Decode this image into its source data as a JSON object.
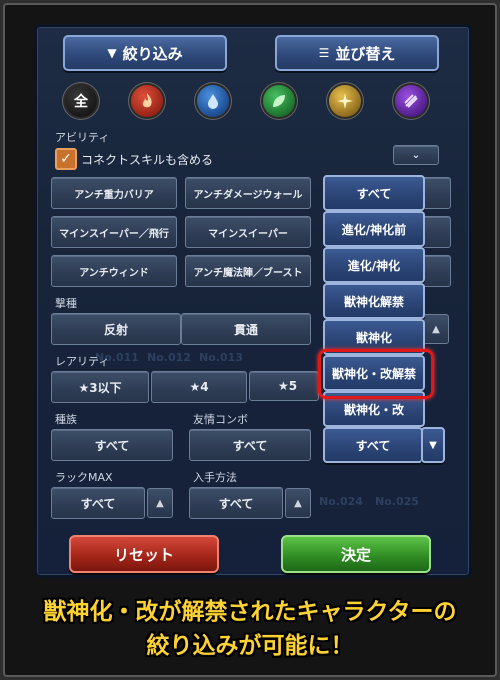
{
  "header": {
    "filter_label": "絞り込み",
    "sort_label": "並び替え"
  },
  "elements": [
    {
      "name": "all",
      "glyph": "全",
      "color": "#1a1a1a"
    },
    {
      "name": "fire",
      "glyph": "",
      "color": "#b8251a"
    },
    {
      "name": "water",
      "glyph": "",
      "color": "#1a5fb0"
    },
    {
      "name": "wood",
      "glyph": "",
      "color": "#1c8a30"
    },
    {
      "name": "light",
      "glyph": "",
      "color": "#b08a18"
    },
    {
      "name": "dark",
      "glyph": "",
      "color": "#6a2aa8"
    }
  ],
  "ability": {
    "label": "アビリティ",
    "connect_skill": "コネクトスキルも含める",
    "options": [
      "アンチ重力バリア",
      "アンチダメージウォール",
      "マインスイーパー／飛行",
      "マインスイーパー",
      "アンチウィンド",
      "アンチ魔法陣／ブースト"
    ]
  },
  "strike_type": {
    "label": "撃種",
    "options": [
      "反射",
      "貫通"
    ]
  },
  "rarity": {
    "label": "レアリティ",
    "options": [
      "★3以下",
      "★4",
      "★5"
    ]
  },
  "race": {
    "label": "種族",
    "value": "すべて"
  },
  "friendship": {
    "label": "友情コンボ",
    "value": "すべて"
  },
  "luck_max": {
    "label": "ラックMAX",
    "value": "すべて"
  },
  "acquisition": {
    "label": "入手方法",
    "value": "すべて"
  },
  "evolution_dropdown": {
    "options": [
      "すべて",
      "進化/神化前",
      "進化/神化",
      "獣神化解禁",
      "獣神化",
      "獣神化・改解禁",
      "獣神化・改"
    ],
    "selected": "すべて"
  },
  "background_numbers": [
    "No.011",
    "No.012",
    "No.013",
    "No.024",
    "No.025"
  ],
  "footer": {
    "reset_label": "リセット",
    "decide_label": "決定"
  },
  "caption": {
    "line1_highlight": "獣神化・改",
    "line1_rest": "が解禁されたキャラクターの",
    "line2": "絞り込みが可能に！"
  }
}
